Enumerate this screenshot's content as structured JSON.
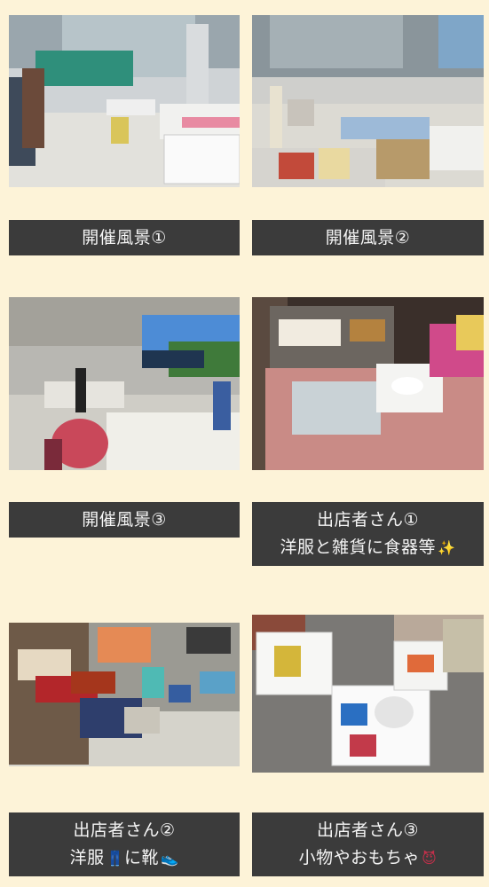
{
  "gallery": {
    "items": [
      {
        "photo_alt": "開催風景①",
        "caption_line1": "開催風景①",
        "caption_line2": ""
      },
      {
        "photo_alt": "開催風景②",
        "caption_line1": "開催風景②",
        "caption_line2": ""
      },
      {
        "photo_alt": "開催風景③",
        "caption_line1": "開催風景③",
        "caption_line2": ""
      },
      {
        "photo_alt": "出店者さん①",
        "caption_line1": "出店者さん①",
        "caption_line2": "洋服と雑貨に食器等",
        "caption_emoji": "✨"
      },
      {
        "photo_alt": "出店者さん②",
        "caption_line1": "出店者さん②",
        "caption_line2_a": "洋服",
        "caption_emoji_a": "👖",
        "caption_line2_b": "に靴",
        "caption_emoji_b": "👟"
      },
      {
        "photo_alt": "出店者さん③",
        "caption_line1": "出店者さん③",
        "caption_line2": "小物やおもちゃ",
        "caption_emoji": "😈"
      }
    ]
  },
  "colors": {
    "page_background": "#fdf3d8",
    "caption_background": "#3b3b3b",
    "caption_text": "#f4f4f4"
  }
}
